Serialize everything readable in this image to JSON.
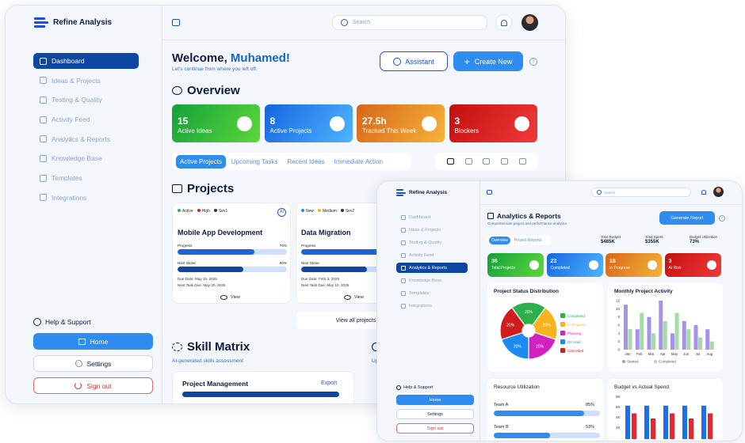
{
  "brand": {
    "name": "Refine Analysis",
    "accent": "#2f8df0",
    "dark": "#0d47a1"
  },
  "main": {
    "nav": [
      "Dashboard",
      "Ideas & Projects",
      "Testing & Quality",
      "Activity Feed",
      "Analytics & Reports",
      "Knowledge Base",
      "Templates",
      "Integrations"
    ],
    "help": "Help & Support",
    "home": "Home",
    "settings": "Settings",
    "signout": "Sign out",
    "search_placeholder": "Search",
    "welcome": "Welcome, ",
    "user": "Muhamed!",
    "welcome_sub": "Let's continue from where you left off.",
    "assistant": "Assistant",
    "create_new": "Create New",
    "overview": "Overview",
    "stats": [
      {
        "n": "15",
        "l": "Active Ideas"
      },
      {
        "n": "8",
        "l": "Active Projects"
      },
      {
        "n": "27.5h",
        "l": "Tracked This Week"
      },
      {
        "n": "3",
        "l": "Blockers"
      }
    ],
    "tabs": [
      "Active Projects",
      "Upcoming Tasks",
      "Recent Ideas",
      "Immediate Action"
    ],
    "projects_title": "Projects",
    "projects": [
      {
        "tags": [
          "Active",
          "High",
          "Sev1"
        ],
        "title": "Mobile App Development",
        "progress_label": "Progress",
        "progress": "70%",
        "progress_value": 70,
        "milestone_label": "Next Stone",
        "milestone": "60%",
        "milestone_value": 60,
        "due": "Due Date: May 15, 2025",
        "next": "Next Task Due: May 20, 2025",
        "view": "View"
      },
      {
        "tags": [
          "New",
          "Medium",
          "Sev2"
        ],
        "title": "Data Migration",
        "progress_label": "Progress",
        "progress_value": 75,
        "milestone_label": "Next Stone",
        "milestone_value": 60,
        "due": "Due Date: Febr 3, 2025",
        "next": "Next Task Due: May 10, 2025",
        "view": "View"
      }
    ],
    "view_all": "View all projects",
    "skill_title": "Skill Matrix",
    "skill_sub": "AI-generated skills assessment",
    "skill_card": "Project Management",
    "export": "Export",
    "up_label": "Up"
  },
  "analytics": {
    "nav": [
      "Dashboard",
      "Ideas & Projects",
      "Testing & Quality",
      "Activity Feed",
      "Analytics & Reports",
      "Knowledge Base",
      "Templates",
      "Integrations"
    ],
    "search_placeholder": "Search",
    "title": "Analytics & Reports",
    "subtitle": "Comprehensive project and performance analytics",
    "generate": "Generate Report",
    "tabs": [
      "Overview",
      "Project Reports"
    ],
    "kpis": [
      {
        "label": "Total Budget",
        "value": "$485K"
      },
      {
        "label": "Total Spent",
        "value": "$355K"
      },
      {
        "label": "Budget Utilization",
        "value": "73%"
      }
    ],
    "stats": [
      {
        "n": "36",
        "l": "Total Projects"
      },
      {
        "n": "23",
        "l": "Completed"
      },
      {
        "n": "18",
        "l": "In Progress"
      },
      {
        "n": "3",
        "l": "At Risk"
      }
    ],
    "help": "Help & Support",
    "home": "Home",
    "settings": "Settings",
    "signout": "Sign out",
    "resource_title": "Resource Utilization",
    "teams": [
      {
        "name": "Team A",
        "pct": "85%",
        "value": 85
      },
      {
        "name": "Team B",
        "pct": "53%",
        "value": 53
      }
    ],
    "budget_title": "Budget vs Actual Spend",
    "budget_ticks": [
      "8K",
      "6K",
      "4K",
      "2K"
    ],
    "budget_bars": [
      [
        6.5,
        5
      ],
      [
        6.5,
        4
      ],
      [
        6.5,
        5
      ],
      [
        6.5,
        4
      ],
      [
        6.5,
        5
      ]
    ]
  },
  "chart_data": [
    {
      "type": "pie",
      "title": "Project Status Distribution",
      "categories": [
        "Completed",
        "In Progress",
        "Planning",
        "On Hold",
        "Cancelled"
      ],
      "values": [
        20,
        20,
        20,
        20,
        20
      ],
      "labels": [
        "20%",
        "20%",
        "20%",
        "20%",
        "20%"
      ],
      "colors": [
        "#2bb04b",
        "#f5b41b",
        "#d021c1",
        "#1c8bf0",
        "#d01c1c"
      ]
    },
    {
      "type": "bar",
      "title": "Monthly Project Activity",
      "categories": [
        "Jan",
        "Feb",
        "Mar",
        "Apr",
        "May",
        "Jun",
        "Jul",
        "Aug"
      ],
      "ylim": [
        0,
        12
      ],
      "yticks": [
        12,
        10,
        8,
        6,
        4,
        2,
        0
      ],
      "series": [
        {
          "name": "Started",
          "values": [
            11,
            5,
            8,
            12,
            4,
            7,
            6,
            5
          ],
          "color": "#a692e8"
        },
        {
          "name": "Completed",
          "values": [
            5,
            9,
            4,
            7,
            9,
            5,
            3,
            2
          ],
          "color": "#a4dba6"
        }
      ]
    }
  ]
}
